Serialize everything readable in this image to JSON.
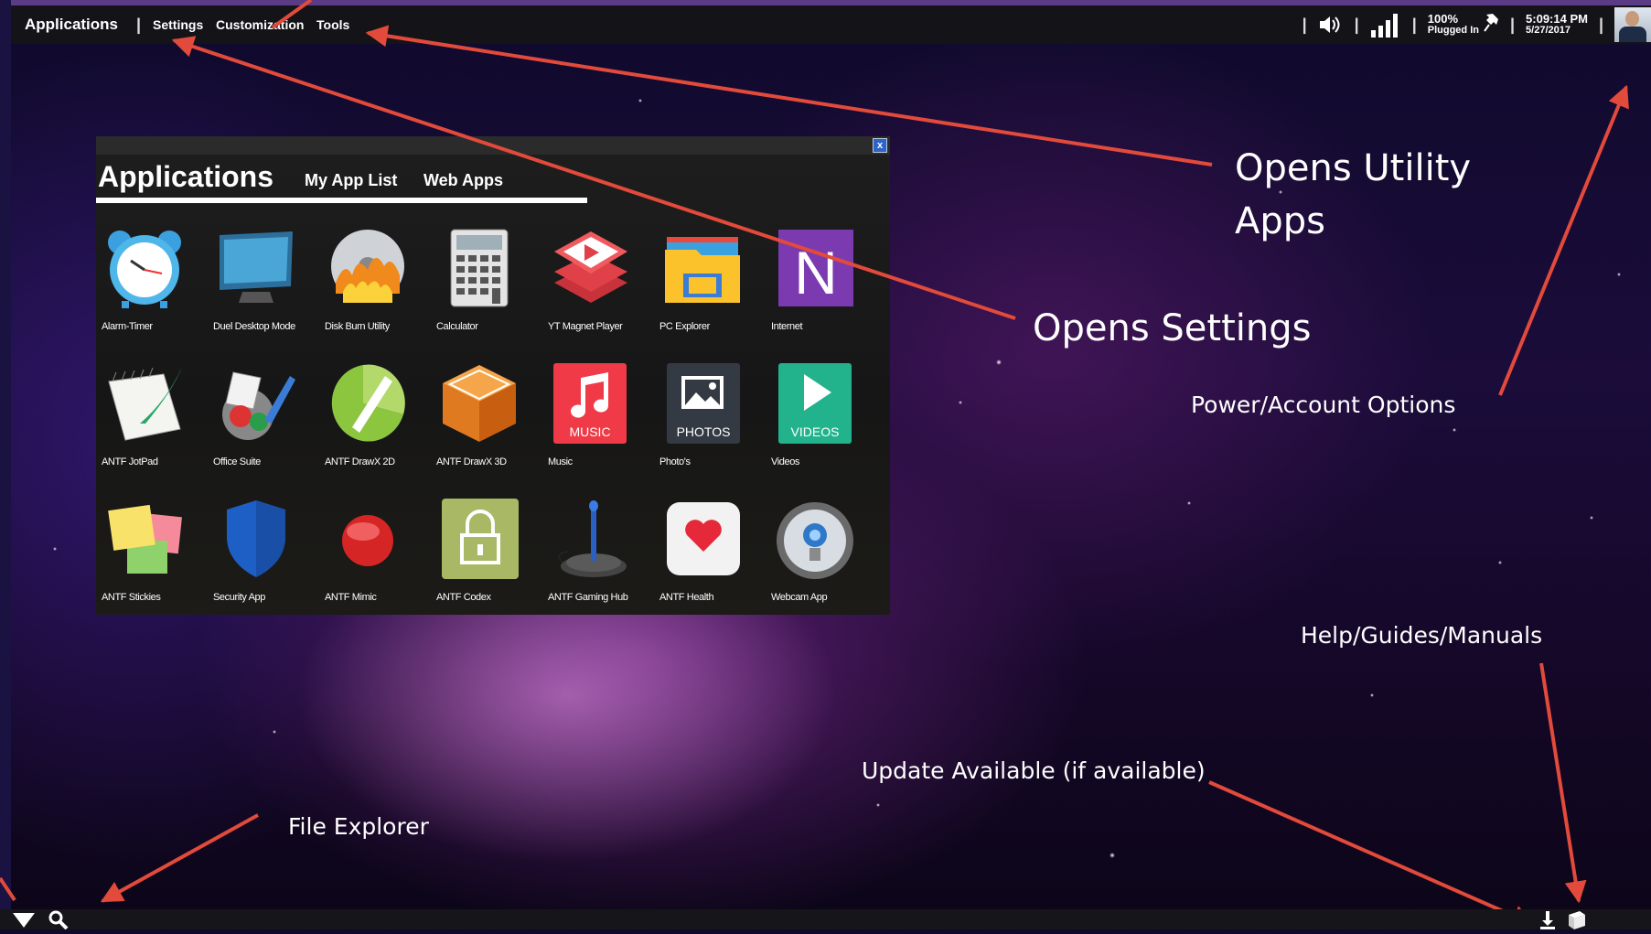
{
  "topbar": {
    "applications": "Applications",
    "separator": "|",
    "settings": "Settings",
    "customization": "Customization",
    "tools": "Tools",
    "battery_percent": "100%",
    "battery_status": "Plugged In",
    "time": "5:09:14 PM",
    "date": "5/27/2017"
  },
  "window": {
    "title": "Applications",
    "tabs": [
      "My App List",
      "Web Apps"
    ],
    "close_label": "x",
    "apps": [
      {
        "label": "Alarm-Timer",
        "icon": "alarm-clock-icon"
      },
      {
        "label": "Duel Desktop Mode",
        "icon": "monitor-icon"
      },
      {
        "label": "Disk Burn Utility",
        "icon": "disc-fire-icon"
      },
      {
        "label": "Calculator",
        "icon": "calculator-icon"
      },
      {
        "label": "YT Magnet Player",
        "icon": "play-stack-icon"
      },
      {
        "label": "PC Explorer",
        "icon": "folder-icon"
      },
      {
        "label": "Internet",
        "icon": "n-letter-icon"
      },
      {
        "label": "ANTF JotPad",
        "icon": "notepad-quill-icon"
      },
      {
        "label": "Office Suite",
        "icon": "office-brush-icon"
      },
      {
        "label": "ANTF DrawX 2D",
        "icon": "pencil-2d-icon"
      },
      {
        "label": "ANTF DrawX 3D",
        "icon": "cube-3d-icon"
      },
      {
        "label": "Music",
        "icon": "music-note-icon"
      },
      {
        "label": "Photo's",
        "icon": "photos-icon"
      },
      {
        "label": "Videos",
        "icon": "videos-play-icon"
      },
      {
        "label": "ANTF Stickies",
        "icon": "sticky-notes-icon"
      },
      {
        "label": "Security App",
        "icon": "shield-icon"
      },
      {
        "label": "ANTF Mimic",
        "icon": "red-ball-icon"
      },
      {
        "label": "ANTF Codex",
        "icon": "padlock-icon"
      },
      {
        "label": "ANTF Gaming Hub",
        "icon": "joystick-icon"
      },
      {
        "label": "ANTF Health",
        "icon": "heart-icon"
      },
      {
        "label": "Webcam App",
        "icon": "webcam-icon"
      }
    ],
    "app_icon_texts": {
      "music": "MUSIC",
      "photos": "PHOTOS",
      "videos": "VIDEOS",
      "internet": "N"
    }
  },
  "annotations": {
    "utility_line1": "Opens Utility",
    "utility_line2": "Apps",
    "settings": "Opens Settings",
    "power": "Power/Account Options",
    "help": "Help/Guides/Manuals",
    "update": "Update Available (if available)",
    "file_explorer": "File Explorer"
  },
  "colors": {
    "annotation_arrow": "#e24a3b",
    "topbar_bg": "#141418",
    "window_bg": "#1e1e1e",
    "close_button": "#2e63c9"
  }
}
